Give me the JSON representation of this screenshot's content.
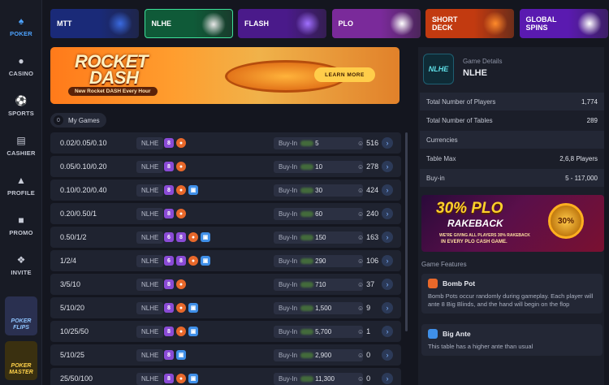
{
  "sidebar": {
    "items": [
      {
        "label": "POKER",
        "icon": "poker-logo-icon"
      },
      {
        "label": "CASINO",
        "icon": "casino-chip-icon"
      },
      {
        "label": "SPORTS",
        "icon": "ball-icon"
      },
      {
        "label": "CASHIER",
        "icon": "wallet-icon"
      },
      {
        "label": "PROFILE",
        "icon": "user-icon"
      },
      {
        "label": "PROMO",
        "icon": "gift-icon"
      },
      {
        "label": "INVITE",
        "icon": "invite-icon"
      }
    ],
    "promos": [
      {
        "label": "POKER FLIPS"
      },
      {
        "label": "POKER MASTER"
      }
    ]
  },
  "tabs": [
    {
      "label": "MTT",
      "color": "#1a2a78"
    },
    {
      "label": "NLHE",
      "color": "#0f5a38"
    },
    {
      "label": "FLASH",
      "color": "#4a1a8a"
    },
    {
      "label": "PLO",
      "color": "#7a2a9a"
    },
    {
      "label": "SHORT DECK",
      "color": "#c23a10"
    },
    {
      "label": "GLOBAL SPINS",
      "color": "#5a1ab0"
    }
  ],
  "banner": {
    "title_1": "ROCKET",
    "title_2": "DASH",
    "subtitle": "New Rocket DASH Every Hour",
    "button": "LEARN MORE"
  },
  "my_games": {
    "count": "0",
    "label": "My Games"
  },
  "tables": [
    {
      "stakes": "0.02/0.05/0.10",
      "game": "NLHE",
      "badges": [
        [
          "purple",
          "8"
        ],
        [
          "orange",
          ""
        ]
      ],
      "buyin_label": "Buy-In",
      "buyin": "5",
      "players": "516"
    },
    {
      "stakes": "0.05/0.10/0.20",
      "game": "NLHE",
      "badges": [
        [
          "purple",
          "8"
        ],
        [
          "orange",
          ""
        ]
      ],
      "buyin_label": "Buy-In",
      "buyin": "10",
      "players": "278"
    },
    {
      "stakes": "0.10/0.20/0.40",
      "game": "NLHE",
      "badges": [
        [
          "purple",
          "8"
        ],
        [
          "orange",
          ""
        ],
        [
          "blue",
          ""
        ]
      ],
      "buyin_label": "Buy-In",
      "buyin": "30",
      "players": "424"
    },
    {
      "stakes": "0.20/0.50/1",
      "game": "NLHE",
      "badges": [
        [
          "purple",
          "8"
        ],
        [
          "orange",
          ""
        ]
      ],
      "buyin_label": "Buy-In",
      "buyin": "60",
      "players": "240"
    },
    {
      "stakes": "0.50/1/2",
      "game": "NLHE",
      "badges": [
        [
          "purple",
          "6"
        ],
        [
          "purple",
          "8"
        ],
        [
          "orange",
          ""
        ],
        [
          "blue",
          ""
        ]
      ],
      "buyin_label": "Buy-In",
      "buyin": "150",
      "players": "163"
    },
    {
      "stakes": "1/2/4",
      "game": "NLHE",
      "badges": [
        [
          "purple",
          "6"
        ],
        [
          "purple",
          "8"
        ],
        [
          "orange",
          ""
        ],
        [
          "blue",
          ""
        ]
      ],
      "buyin_label": "Buy-In",
      "buyin": "290",
      "players": "106"
    },
    {
      "stakes": "3/5/10",
      "game": "NLHE",
      "badges": [
        [
          "purple",
          "8"
        ],
        [
          "orange",
          ""
        ]
      ],
      "buyin_label": "Buy-In",
      "buyin": "710",
      "players": "37"
    },
    {
      "stakes": "5/10/20",
      "game": "NLHE",
      "badges": [
        [
          "purple",
          "8"
        ],
        [
          "orange",
          ""
        ],
        [
          "blue",
          ""
        ]
      ],
      "buyin_label": "Buy-In",
      "buyin": "1,500",
      "players": "9"
    },
    {
      "stakes": "10/25/50",
      "game": "NLHE",
      "badges": [
        [
          "purple",
          "8"
        ],
        [
          "orange",
          ""
        ],
        [
          "blue",
          ""
        ]
      ],
      "buyin_label": "Buy-In",
      "buyin": "5,700",
      "players": "1"
    },
    {
      "stakes": "5/10/25",
      "game": "NLHE",
      "badges": [
        [
          "purple",
          "8"
        ],
        [
          "blue",
          ""
        ]
      ],
      "buyin_label": "Buy-In",
      "buyin": "2,900",
      "players": "0"
    },
    {
      "stakes": "25/50/100",
      "game": "NLHE",
      "badges": [
        [
          "purple",
          "8"
        ],
        [
          "orange",
          ""
        ],
        [
          "blue",
          ""
        ]
      ],
      "buyin_label": "Buy-In",
      "buyin": "11,300",
      "players": "0"
    }
  ],
  "details": {
    "label": "Game Details",
    "name": "NLHE",
    "logo": "NLHE",
    "rows": [
      {
        "key": "Total Number of Players",
        "value": "1,774"
      },
      {
        "key": "Total Number of Tables",
        "value": "289"
      },
      {
        "key": "Currencies",
        "value": ""
      },
      {
        "key": "Table Max",
        "value": "2,6,8 Players"
      },
      {
        "key": "Buy-in",
        "value": "5 -  117,000"
      }
    ]
  },
  "rakeback": {
    "title": "30% PLO",
    "subtitle": "RAKEBACK",
    "small": "WE'RE GIVING ALL PLAYERS 30% RAKEBACK",
    "small2": "IN EVERY PLO CASH GAME.",
    "coin": "30%"
  },
  "features": {
    "label": "Game Features",
    "items": [
      {
        "title": "Bomb Pot",
        "color": "#e8682a",
        "desc": "Bomb Pots occur randomly during gameplay. Each player will ante 8 Big Blinds, and the hand will begin on the flop"
      },
      {
        "title": "Big Ante",
        "color": "#3f8fe8",
        "desc": "This table has a higher ante than usual"
      }
    ]
  }
}
